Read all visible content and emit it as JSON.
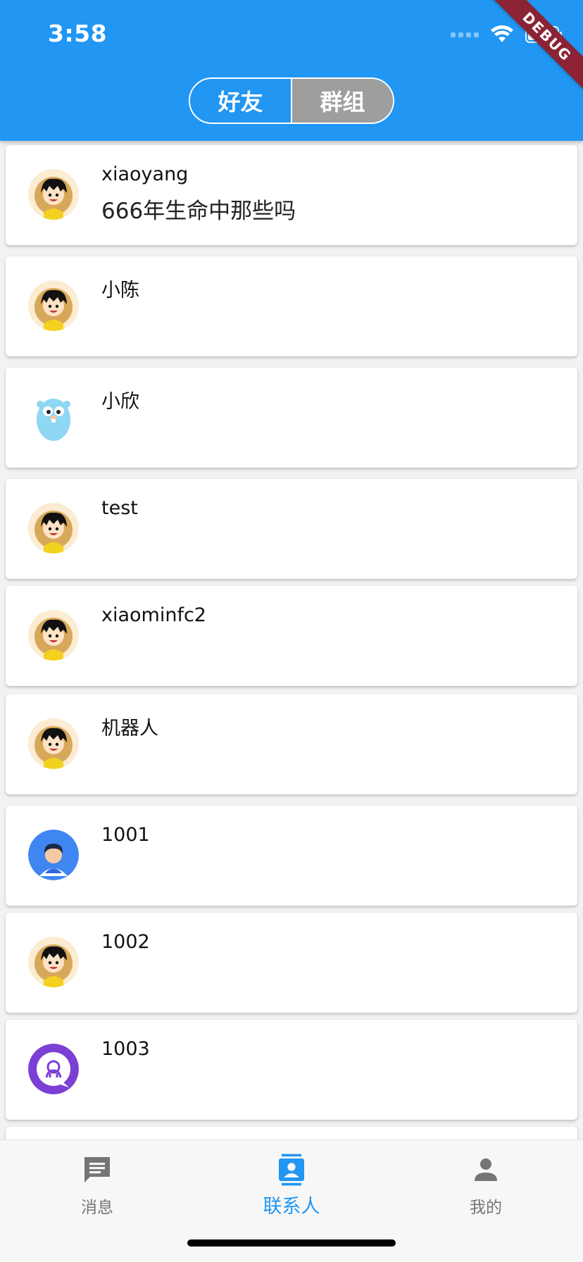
{
  "status_bar": {
    "time": "3:58"
  },
  "debug_banner": "DEBUG",
  "segment_tabs": {
    "friends_label": "好友",
    "groups_label": "群组",
    "selected": "群组"
  },
  "contacts": [
    {
      "name": "xiaoyang",
      "subtitle": "666年生命中那些吗",
      "avatar": "cartoon-boy-avatar"
    },
    {
      "name": "小陈",
      "subtitle": "",
      "avatar": "cartoon-boy-avatar"
    },
    {
      "name": "小欣",
      "subtitle": "",
      "avatar": "blue-gopher-avatar"
    },
    {
      "name": "test",
      "subtitle": "",
      "avatar": "cartoon-boy-avatar"
    },
    {
      "name": "xiaominfc2",
      "subtitle": "",
      "avatar": "cartoon-boy-avatar"
    },
    {
      "name": "机器人",
      "subtitle": "",
      "avatar": "cartoon-boy-avatar"
    },
    {
      "name": "1001",
      "subtitle": "",
      "avatar": "blue-person-avatar"
    },
    {
      "name": "1002",
      "subtitle": "",
      "avatar": "cartoon-boy-avatar"
    },
    {
      "name": "1003",
      "subtitle": "",
      "avatar": "purple-chat-avatar"
    }
  ],
  "bottom_nav": {
    "items": [
      {
        "label": "消息",
        "icon": "chat-bubble-icon",
        "active": false
      },
      {
        "label": "联系人",
        "icon": "contacts-card-icon",
        "active": true
      },
      {
        "label": "我的",
        "icon": "person-icon",
        "active": false
      }
    ]
  },
  "colors": {
    "primary": "#2196f3",
    "segment_selected": "#9e9e9e",
    "inactive_nav": "#757575",
    "debug_ribbon": "#8b2335"
  }
}
